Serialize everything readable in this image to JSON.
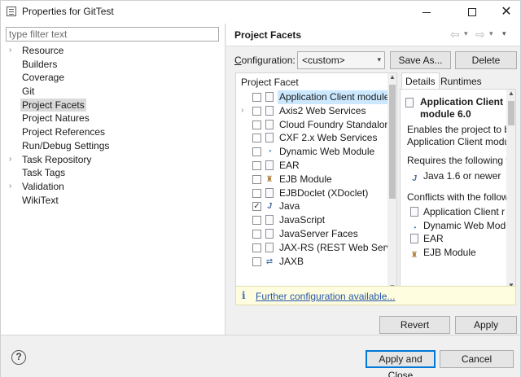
{
  "window": {
    "title": "Properties for GitTest",
    "min_glyph": "",
    "max_glyph": "",
    "close_glyph": "✕"
  },
  "filter": {
    "placeholder": "type filter text"
  },
  "tree": {
    "items": [
      {
        "label": "Resource",
        "expandable": true
      },
      {
        "label": "Builders",
        "expandable": false
      },
      {
        "label": "Coverage",
        "expandable": false
      },
      {
        "label": "Git",
        "expandable": false
      },
      {
        "label": "Project Facets",
        "expandable": false,
        "selected": true
      },
      {
        "label": "Project Natures",
        "expandable": false
      },
      {
        "label": "Project References",
        "expandable": false
      },
      {
        "label": "Run/Debug Settings",
        "expandable": false
      },
      {
        "label": "Task Repository",
        "expandable": true
      },
      {
        "label": "Task Tags",
        "expandable": false
      },
      {
        "label": "Validation",
        "expandable": true
      },
      {
        "label": "WikiText",
        "expandable": false
      }
    ]
  },
  "page": {
    "title": "Project Facets",
    "nav_back": "⇦",
    "nav_fwd": "⇨",
    "dropdown_glyph": "▾"
  },
  "config": {
    "label_prefix": "C",
    "label_rest": "onfiguration:",
    "value": "<custom>",
    "save_as_label": "Save As...",
    "delete_label": "Delete"
  },
  "facets": {
    "header": "Project Facet",
    "rows": [
      {
        "label": "Application Client module",
        "checked": false,
        "icon": "doc",
        "selected": true,
        "expander": ""
      },
      {
        "label": "Axis2 Web Services",
        "checked": false,
        "icon": "doc",
        "expander": "›"
      },
      {
        "label": "Cloud Foundry Standalone A",
        "checked": false,
        "icon": "doc",
        "expander": ""
      },
      {
        "label": "CXF 2.x Web Services",
        "checked": false,
        "icon": "doc",
        "expander": ""
      },
      {
        "label": "Dynamic Web Module",
        "checked": false,
        "icon": "globe",
        "expander": ""
      },
      {
        "label": "EAR",
        "checked": false,
        "icon": "doc",
        "expander": ""
      },
      {
        "label": "EJB Module",
        "checked": false,
        "icon": "jar",
        "expander": ""
      },
      {
        "label": "EJBDoclet (XDoclet)",
        "checked": false,
        "icon": "doc",
        "expander": ""
      },
      {
        "label": "Java",
        "checked": true,
        "icon": "j",
        "expander": ""
      },
      {
        "label": "JavaScript",
        "checked": false,
        "icon": "doc",
        "expander": ""
      },
      {
        "label": "JavaServer Faces",
        "checked": false,
        "icon": "doc",
        "expander": ""
      },
      {
        "label": "JAX-RS (REST Web Services",
        "checked": false,
        "icon": "doc",
        "expander": ""
      },
      {
        "label": "JAXB",
        "checked": false,
        "icon": "jx",
        "expander": ""
      }
    ]
  },
  "details": {
    "tab_details": "Details",
    "tab_runtimes": "Runtimes",
    "title": "Application Client module 6.0",
    "enables_line1": "Enables the project to b",
    "enables_line2": "Application Client modu",
    "requires_label": "Requires the following f",
    "requires_items": [
      {
        "label": "Java 1.6 or newer",
        "icon": "j"
      }
    ],
    "conflicts_label": "Conflicts with the follow",
    "conflicts_items": [
      {
        "label": "Application Client r",
        "icon": "doc"
      },
      {
        "label": "Dynamic Web Modu",
        "icon": "globe"
      },
      {
        "label": "EAR",
        "icon": "doc"
      },
      {
        "label": "EJB Module",
        "icon": "jar"
      }
    ]
  },
  "info": {
    "icon_glyph": "i",
    "link": "Further configuration available..."
  },
  "buttons": {
    "revert": "Revert",
    "apply": "Apply",
    "apply_and_close": "Apply and Close",
    "cancel": "Cancel",
    "help_glyph": "?"
  }
}
